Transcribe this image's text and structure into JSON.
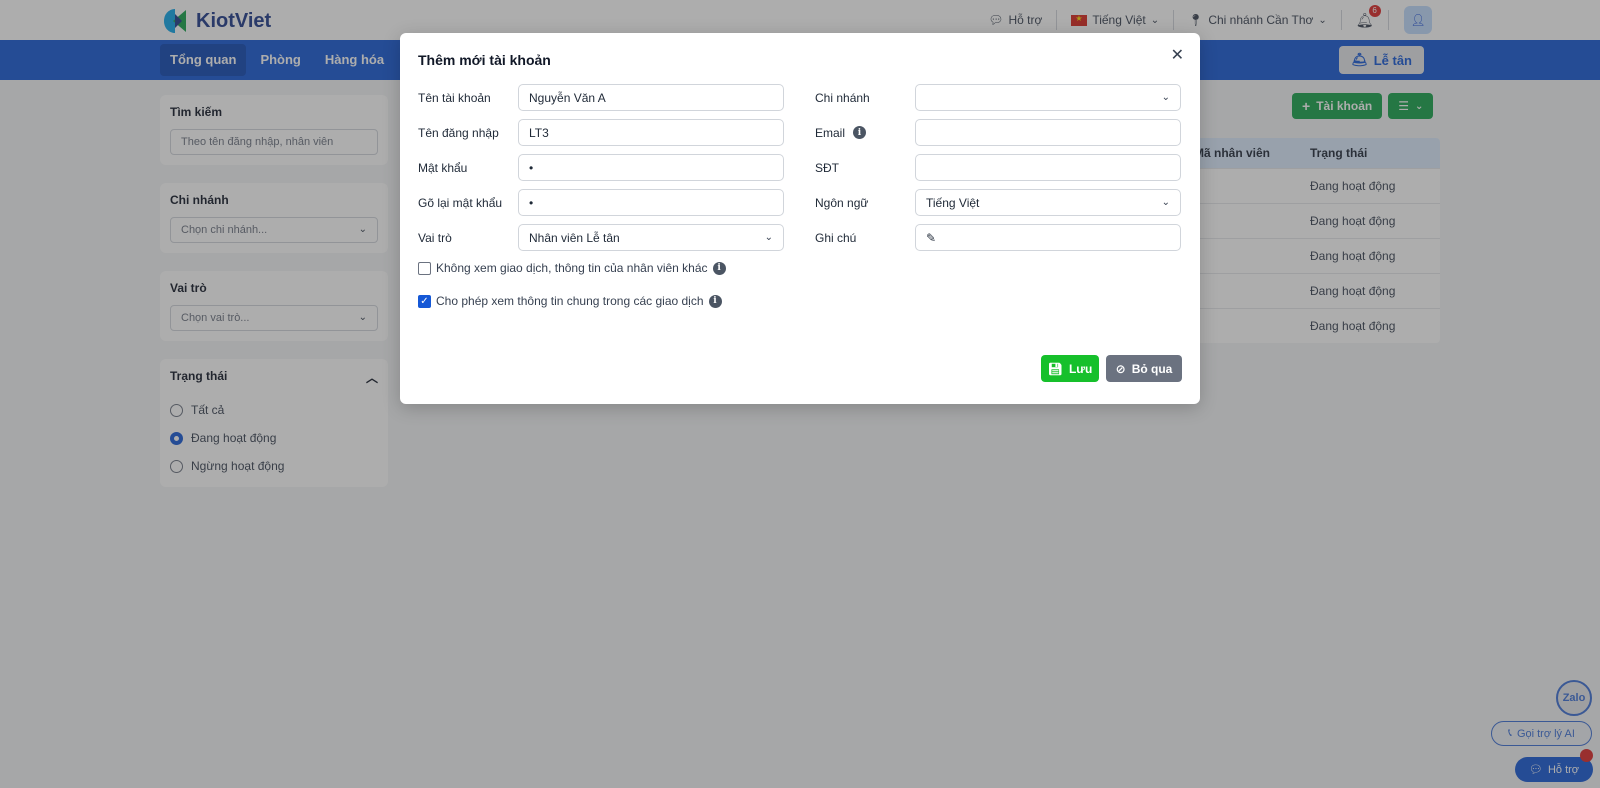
{
  "header": {
    "brand": "KiotViet",
    "support": "Hỗ trợ",
    "language": "Tiếng Việt",
    "branch": "Chi nhánh Cần Thơ",
    "notif_count": "6"
  },
  "nav": {
    "tabs": [
      "Tổng quan",
      "Phòng",
      "Hàng hóa"
    ],
    "reception": "Lễ tân"
  },
  "sidebar": {
    "search_title": "Tìm kiếm",
    "search_placeholder": "Theo tên đăng nhập, nhân viên",
    "branch_title": "Chi nhánh",
    "branch_placeholder": "Chọn chi nhánh...",
    "role_title": "Vai trò",
    "role_placeholder": "Chọn vai trò...",
    "status_title": "Trạng thái",
    "status_options": [
      "Tất cả",
      "Đang hoạt động",
      "Ngừng hoạt động"
    ]
  },
  "list": {
    "add_label": "Tài khoản",
    "col_employee": "Mã nhân viên",
    "col_status": "Trạng thái",
    "rows": [
      "Đang hoạt động",
      "Đang hoạt động",
      "Đang hoạt động",
      "Đang hoạt động",
      "Đang hoạt động"
    ]
  },
  "modal": {
    "title": "Thêm mới tài khoản",
    "account_name_label": "Tên tài khoản",
    "account_name_value": "Nguyễn Văn A",
    "username_label": "Tên đăng nhập",
    "username_value": "LT3",
    "password_label": "Mật khẩu",
    "password_value": "•",
    "repassword_label": "Gõ lại mật khẩu",
    "repassword_value": "•",
    "role_label": "Vai trò",
    "role_value": "Nhân viên Lễ tân",
    "branch_label": "Chi nhánh",
    "branch_value": "",
    "email_label": "Email",
    "email_value": "",
    "phone_label": "SĐT",
    "phone_value": "",
    "language_label": "Ngôn ngữ",
    "language_value": "Tiếng Việt",
    "note_label": "Ghi chú",
    "note_value": "",
    "checkbox1": "Không xem giao dịch, thông tin của nhân viên khác",
    "checkbox2": "Cho phép xem thông tin chung trong các giao dịch",
    "save": "Lưu",
    "cancel": "Bỏ qua"
  },
  "floating": {
    "zalo": "Zalo",
    "ai": "Gọi trợ lý AI",
    "help": "Hỗ trợ"
  }
}
